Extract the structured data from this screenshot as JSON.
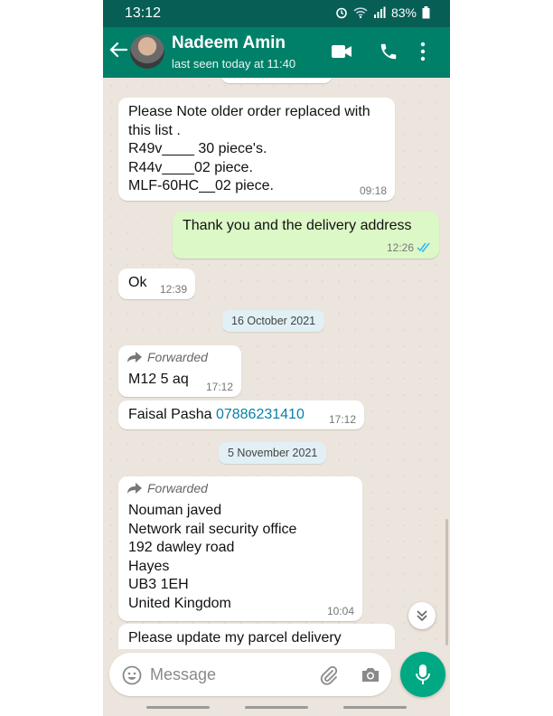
{
  "status_bar": {
    "time": "13:12",
    "battery": "83%"
  },
  "header": {
    "contact_name": "Nadeem Amin",
    "last_seen": "last seen today at 11:40"
  },
  "messages": [
    {
      "lines": [
        "Please Note older order replaced with",
        "this list .",
        "R49v____ 30 piece's.",
        "R44v____02 piece.",
        "MLF-60HC__02 piece."
      ],
      "time": "09:18"
    },
    {
      "text": "Thank you and the delivery address",
      "time": "12:26"
    },
    {
      "text": "Ok",
      "time": "12:39"
    },
    {
      "forwarded_label": "Forwarded",
      "text": "M12 5 aq",
      "time": "17:12"
    },
    {
      "name": "Faisal Pasha",
      "phone": "07886231410",
      "time": "17:12"
    },
    {
      "forwarded_label": "Forwarded",
      "lines": [
        "Nouman javed",
        "Network rail security office",
        "192 dawley road",
        "Hayes",
        "UB3 1EH",
        "United Kingdom"
      ],
      "time": "10:04"
    },
    {
      "text": "Please update my parcel delivery"
    }
  ],
  "date_separators": [
    "16 October 2021",
    "5 November 2021"
  ],
  "input": {
    "placeholder": "Message"
  },
  "colors": {
    "header": "#008069",
    "status_bar": "#075e54",
    "outgoing_bubble": "#dcf8c6",
    "mic_button": "#00a884",
    "read_ticks": "#34b7f1"
  }
}
